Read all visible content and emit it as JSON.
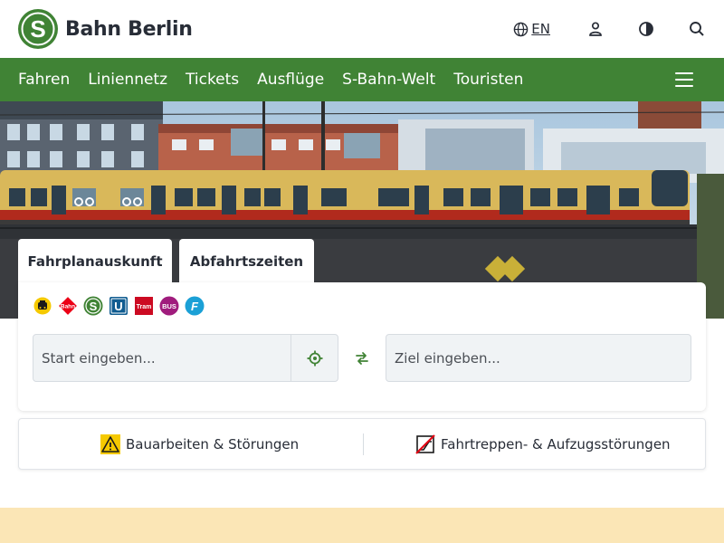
{
  "header": {
    "logo_letter": "S",
    "logo_text": "Bahn Berlin",
    "language": "EN",
    "icons": [
      "globe-icon",
      "user-icon",
      "contrast-icon",
      "search-icon"
    ]
  },
  "nav": {
    "items": [
      "Fahren",
      "Liniennetz",
      "Tickets",
      "Ausflüge",
      "S-Bahn-Welt",
      "Touristen"
    ],
    "menu_icon": "hamburger-menu-icon"
  },
  "colors": {
    "brand_green": "#408335",
    "band_yellow": "#fbe6b6",
    "train_yellow": "#d9b85a",
    "train_red": "#b12a1d"
  },
  "tabs": {
    "journey": "Fahrplanauskunft",
    "departures": "Abfahrtszeiten"
  },
  "transport_modes": [
    "taxi-icon",
    "db-bahn-icon",
    "s-bahn-icon",
    "u-bahn-icon",
    "tram-icon",
    "bus-icon",
    "ferry-icon"
  ],
  "mode_labels": {
    "bahn": "Bahn",
    "s": "S",
    "u": "U",
    "tram": "Tram",
    "bus": "BUS",
    "ferry": "F"
  },
  "search": {
    "start_placeholder": "Start eingeben...",
    "ziel_placeholder": "Ziel eingeben..."
  },
  "info": {
    "construction": "Bauarbeiten & Störungen",
    "escalators": "Fahrtreppen- & Aufzugsstörungen"
  }
}
